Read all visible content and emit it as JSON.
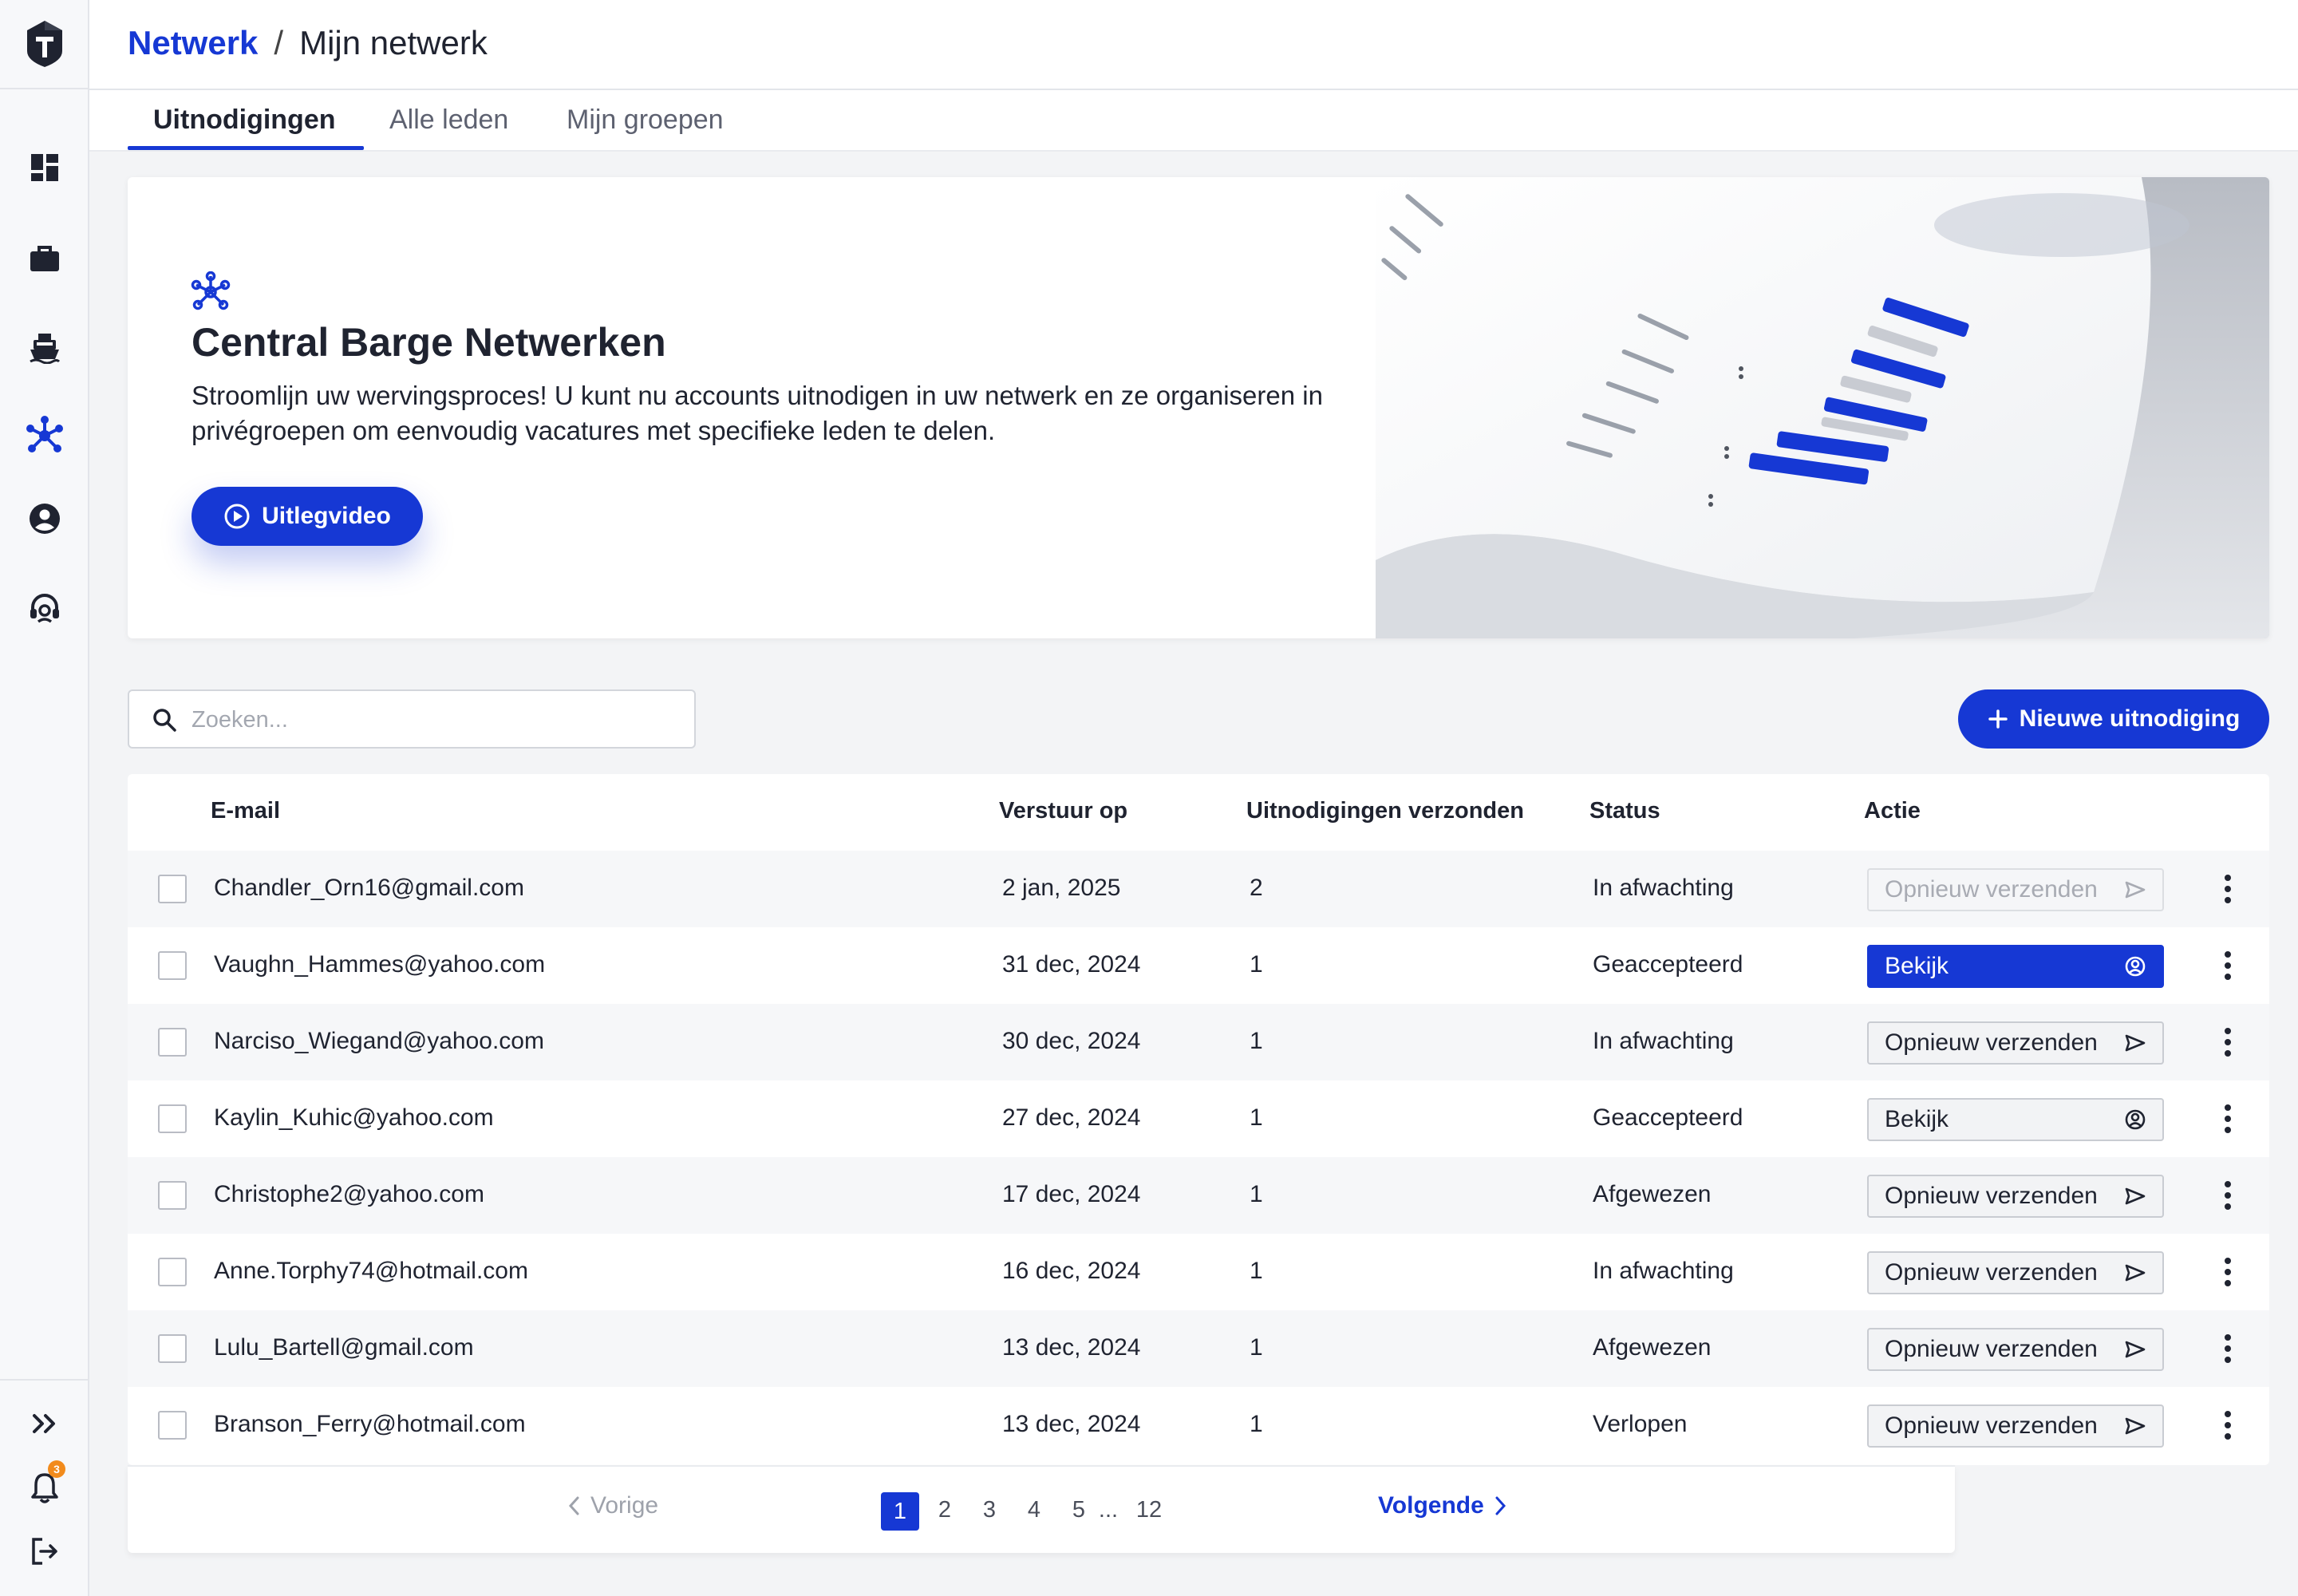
{
  "header": {
    "breadcrumb_root": "Netwerk",
    "breadcrumb_sep": "/",
    "breadcrumb_current": "Mijn netwerk"
  },
  "tabs": [
    {
      "label": "Uitnodigingen",
      "active": true
    },
    {
      "label": "Alle leden",
      "active": false
    },
    {
      "label": "Mijn groepen",
      "active": false
    }
  ],
  "sidebar": {
    "items": [
      "dashboard-icon",
      "briefcase-icon",
      "ship-icon",
      "network-icon",
      "account-icon",
      "support-icon"
    ],
    "notifications_badge": "3"
  },
  "hero": {
    "title": "Central Barge Netwerken",
    "description": "Stroomlijn uw wervingsproces! U kunt nu accounts uitnodigen in uw netwerk en ze organiseren in privégroepen om eenvoudig vacatures met specifieke leden te delen.",
    "button_label": "Uitlegvideo"
  },
  "search": {
    "placeholder": "Zoeken..."
  },
  "new_invite_label": "Nieuwe uitnodiging",
  "table": {
    "columns": [
      "E-mail",
      "Verstuur op",
      "Uitnodigingen verzonden",
      "Status",
      "Actie"
    ],
    "rows": [
      {
        "email": "Chandler_Orn16@gmail.com",
        "date": "2 jan, 2025",
        "sent": "2",
        "status": "In afwachting",
        "action": "Opnieuw verzenden",
        "action_state": "disabled",
        "action_icon": "send-icon"
      },
      {
        "email": "Vaughn_Hammes@yahoo.com",
        "date": "31 dec, 2024",
        "sent": "1",
        "status": "Geaccepteerd",
        "action": "Bekijk",
        "action_state": "primary",
        "action_icon": "user-circle-icon"
      },
      {
        "email": "Narciso_Wiegand@yahoo.com",
        "date": "30 dec, 2024",
        "sent": "1",
        "status": "In afwachting",
        "action": "Opnieuw verzenden",
        "action_state": "default",
        "action_icon": "send-icon"
      },
      {
        "email": "Kaylin_Kuhic@yahoo.com",
        "date": "27 dec, 2024",
        "sent": "1",
        "status": "Geaccepteerd",
        "action": "Bekijk",
        "action_state": "default",
        "action_icon": "user-circle-icon"
      },
      {
        "email": "Christophe2@yahoo.com",
        "date": "17 dec, 2024",
        "sent": "1",
        "status": "Afgewezen",
        "action": "Opnieuw verzenden",
        "action_state": "default",
        "action_icon": "send-icon"
      },
      {
        "email": "Anne.Torphy74@hotmail.com",
        "date": "16 dec, 2024",
        "sent": "1",
        "status": "In afwachting",
        "action": "Opnieuw verzenden",
        "action_state": "default",
        "action_icon": "send-icon"
      },
      {
        "email": "Lulu_Bartell@gmail.com",
        "date": "13 dec, 2024",
        "sent": "1",
        "status": "Afgewezen",
        "action": "Opnieuw verzenden",
        "action_state": "default",
        "action_icon": "send-icon"
      },
      {
        "email": "Branson_Ferry@hotmail.com",
        "date": "13 dec, 2024",
        "sent": "1",
        "status": "Verlopen",
        "action": "Opnieuw verzenden",
        "action_state": "default",
        "action_icon": "send-icon"
      }
    ]
  },
  "pagination": {
    "prev_label": "Vorige",
    "next_label": "Volgende",
    "pages": [
      "1",
      "2",
      "3",
      "4",
      "5",
      "...",
      "12"
    ],
    "current": "1"
  },
  "colors": {
    "accent": "#1638d4",
    "badge": "#f28b1c"
  }
}
